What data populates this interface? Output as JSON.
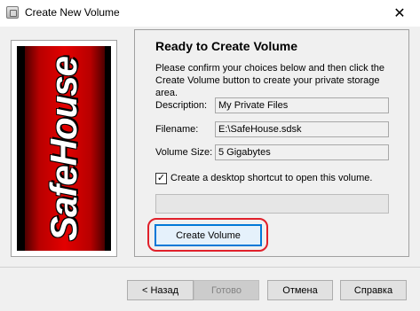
{
  "window": {
    "title": "Create New Volume",
    "close_glyph": "✕",
    "icon": "app-icon"
  },
  "logo": {
    "text": "SafeHouse"
  },
  "content": {
    "heading": "Ready to Create Volume",
    "description_line1": "Please confirm your choices below and then click the",
    "description_line2": "Create Volume button to create your private storage area.",
    "fields": {
      "description": {
        "label": "Description:",
        "value": "My Private Files"
      },
      "filename": {
        "label": "Filename:",
        "value": "E:\\SafeHouse.sdsk"
      },
      "volume_size": {
        "label": "Volume Size:",
        "value": "5 Gigabytes"
      }
    },
    "shortcut_checkbox": {
      "label": "Create a desktop shortcut to open this volume.",
      "checked": true,
      "glyph": "✓"
    },
    "progress": 0,
    "create_button": "Create Volume"
  },
  "footer": {
    "back": "< Назад",
    "done": "Готово",
    "cancel": "Отмена",
    "help": "Справка"
  },
  "colors": {
    "accent_highlight": "#e0202a",
    "focus_border": "#0078d7",
    "logo_red": "#e30000"
  }
}
